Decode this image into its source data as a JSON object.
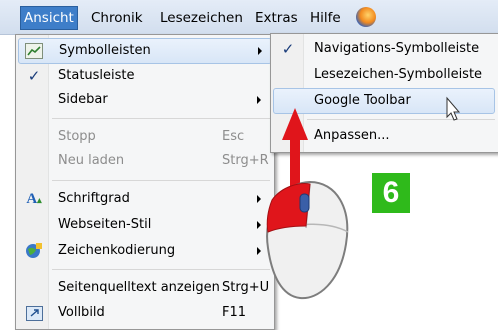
{
  "menubar": {
    "items": [
      {
        "label": "Ansicht"
      },
      {
        "label": "Chronik"
      },
      {
        "label": "Lesezeichen"
      },
      {
        "label": "Extras"
      },
      {
        "label": "Hilfe"
      }
    ],
    "help_icon": "firefox-help-icon"
  },
  "view_menu": {
    "items": [
      {
        "label": "Symbolleisten",
        "submenu": true,
        "icon": "toolbar-icon"
      },
      {
        "label": "Statusleiste",
        "checked": true
      },
      {
        "label": "Sidebar",
        "submenu": true
      },
      {
        "label": "Stopp",
        "shortcut": "Esc",
        "disabled": true
      },
      {
        "label": "Neu laden",
        "shortcut": "Strg+R",
        "disabled": true
      },
      {
        "label": "Schriftgrad",
        "submenu": true,
        "icon": "font-size-icon"
      },
      {
        "label": "Webseiten-Stil",
        "submenu": true
      },
      {
        "label": "Zeichenkodierung",
        "submenu": true,
        "icon": "encoding-icon"
      },
      {
        "label": "Seitenquelltext anzeigen",
        "shortcut": "Strg+U"
      },
      {
        "label": "Vollbild",
        "shortcut": "F11",
        "icon": "fullscreen-icon"
      }
    ]
  },
  "toolbars_submenu": {
    "items": [
      {
        "label": "Navigations-Symbolleiste",
        "checked": true
      },
      {
        "label": "Lesezeichen-Symbolleiste",
        "checked": false
      },
      {
        "label": "Google Toolbar",
        "checked": false,
        "highlighted": true
      },
      {
        "label": "Anpassen...",
        "checked": false
      }
    ]
  },
  "annotation": {
    "step_number": "6",
    "colors": {
      "badge": "#2fba1b",
      "arrow": "#e0151b",
      "menu_highlight": "#3e7ec9"
    }
  }
}
